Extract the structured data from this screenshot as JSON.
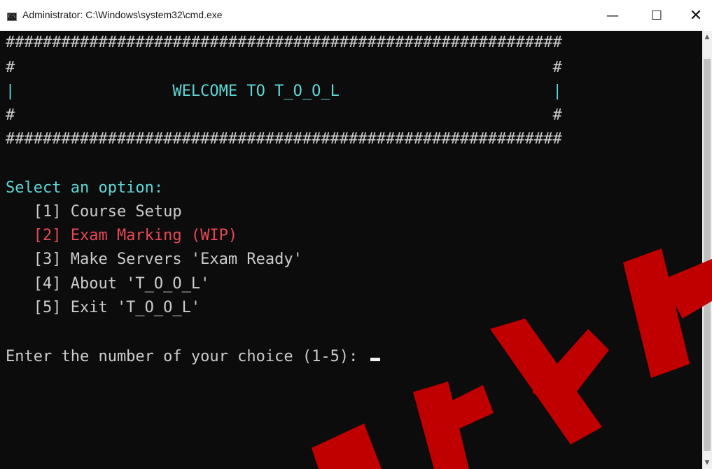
{
  "window": {
    "title": "Administrator: C:\\Windows\\system32\\cmd.exe",
    "icon": "cmd-icon",
    "icon_glyph": "C:\\",
    "minimize_glyph": "—",
    "maximize_glyph": "☐",
    "close_glyph": "✕"
  },
  "console": {
    "border_line": "############################################################",
    "banner_empty_line": "#                                                          #",
    "banner_title_line": "|                 WELCOME TO T_O_O_L                       |",
    "prompt_heading": "Select an option:",
    "options": [
      {
        "label": "   [1] Course Setup",
        "color": "#cccccc"
      },
      {
        "label": "   [2] Exam Marking (WIP)",
        "color": "#e74856"
      },
      {
        "label": "   [3] Make Servers 'Exam Ready'",
        "color": "#cccccc"
      },
      {
        "label": "   [4] About 'T_O_O_L'",
        "color": "#cccccc"
      },
      {
        "label": "   [5] Exit 'T_O_O_L'",
        "color": "#cccccc"
      }
    ],
    "input_prompt": "Enter the number of your choice (1-5): "
  },
  "scrollbar": {
    "up_glyph": "▲",
    "down_glyph": "▼"
  },
  "colors": {
    "background": "#0c0c0c",
    "teal": "#61d6d6",
    "red": "#e74856",
    "text": "#cccccc",
    "watermark": "#c00000"
  }
}
